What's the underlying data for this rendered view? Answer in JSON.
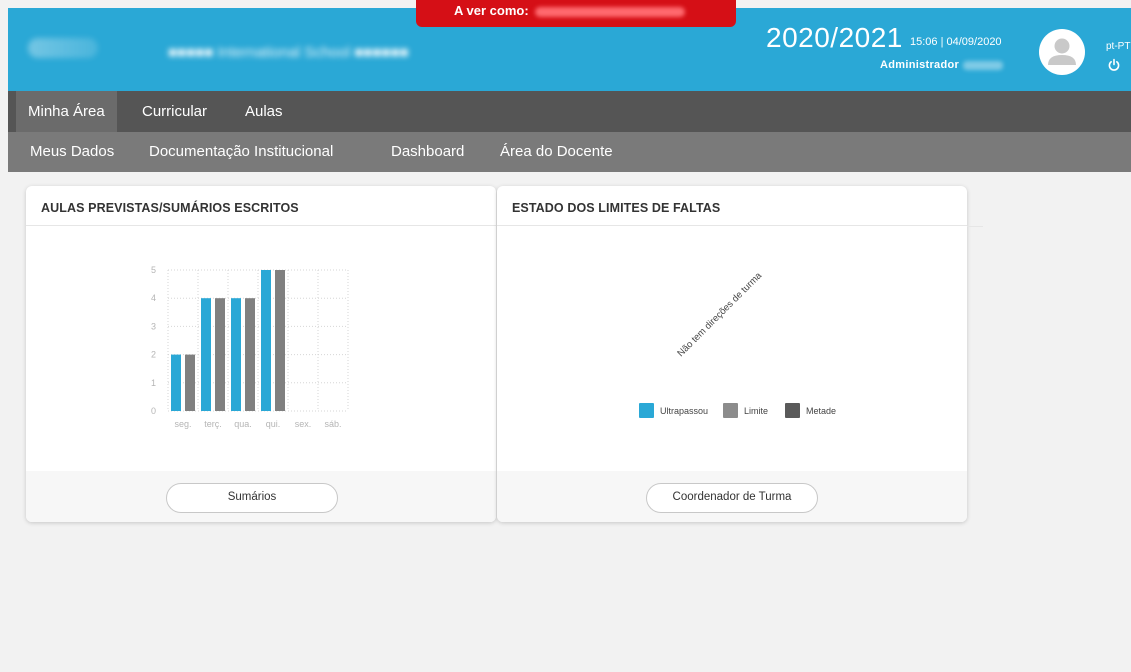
{
  "header": {
    "viewing_as_label": "A ver como:",
    "school_year": "2020/2021",
    "datetime": "15:06 | 04/09/2020",
    "role": "Administrador",
    "language": "pt-PT",
    "colors": {
      "header_bg": "#2aa8d6",
      "viewing_as_bg": "#d50f16"
    }
  },
  "nav": {
    "primary": [
      "Minha Área",
      "Curricular",
      "Aulas"
    ],
    "primary_active": "Minha Área",
    "secondary": [
      "Meus Dados",
      "Documentação Institucional",
      "Dashboard",
      "Área do Docente"
    ]
  },
  "cards": {
    "lessons": {
      "title": "AULAS PREVISTAS/SUMÁRIOS ESCRITOS",
      "button": "Sumários"
    },
    "absences": {
      "title": "ESTADO DOS LIMITES DE FALTAS",
      "button": "Coordenador de Turma",
      "empty_message": "Não tem direções de turma"
    }
  },
  "chart_data": [
    {
      "type": "bar",
      "categories": [
        "seg.",
        "terç.",
        "qua.",
        "qui.",
        "sex.",
        "sáb."
      ],
      "series": [
        {
          "values": [
            2,
            4,
            4,
            5,
            0,
            0
          ],
          "color": "#2aa8d6"
        },
        {
          "values": [
            2,
            4,
            4,
            5,
            0,
            0
          ],
          "color": "#808080"
        }
      ],
      "y_ticks": [
        "0",
        "1",
        "2",
        "3",
        "4",
        "5"
      ],
      "ylim": [
        0,
        5
      ],
      "grid": true
    },
    {
      "type": "bar",
      "legend": [
        {
          "name": "Ultrapassou",
          "color": "#2aa8d6"
        },
        {
          "name": "Limite",
          "color": "#8c8c8c"
        },
        {
          "name": "Metade",
          "color": "#5a5a5a"
        }
      ],
      "legend_position": "bottom-center"
    }
  ]
}
